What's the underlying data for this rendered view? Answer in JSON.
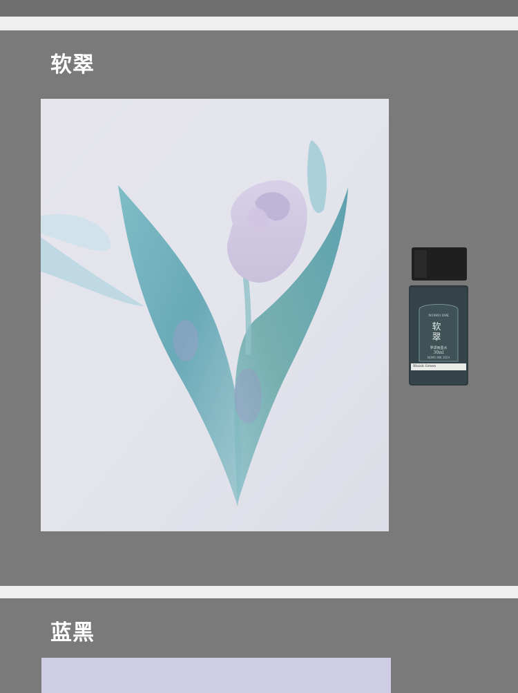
{
  "sections": [
    {
      "title": "软翠",
      "bottle": {
        "brand": "NOMO INK",
        "name": "软翠",
        "subtitle": "罗颂雨墨水",
        "volume": "30ml",
        "code": "NOMO INK 2024",
        "english_name": "Bluish Green"
      }
    },
    {
      "title": "蓝黑"
    }
  ],
  "colors": {
    "background": "#7a7a7a",
    "separator": "#efefef",
    "ink_teal": "#5fa7b1",
    "bottle_glass": "#2f3b3f",
    "bottle_cap": "#1f1f1f"
  }
}
